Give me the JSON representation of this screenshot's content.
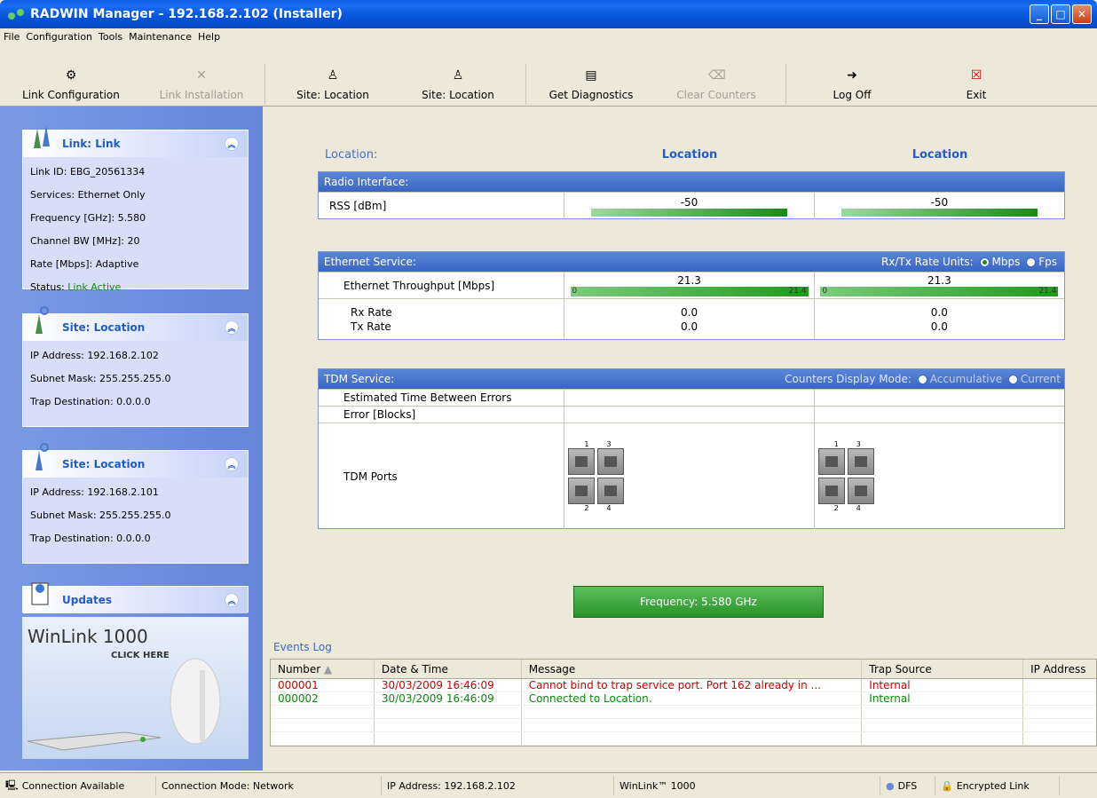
{
  "window": {
    "title": "RADWIN Manager - 192.168.2.102 (Installer)"
  },
  "menu": [
    "File",
    "Configuration",
    "Tools",
    "Maintenance",
    "Help"
  ],
  "toolbar": {
    "link_configuration": "Link Configuration",
    "link_installation": "Link Installation",
    "site_location_1": "Site: Location",
    "site_location_2": "Site: Location",
    "get_diagnostics": "Get Diagnostics",
    "clear_counters": "Clear Counters",
    "log_off": "Log Off",
    "exit": "Exit"
  },
  "link_panel": {
    "title": "Link: Link",
    "link_id": "Link ID:  EBG_20561334",
    "services": "Services:  Ethernet Only",
    "frequency": "Frequency [GHz]:  5.580",
    "channel_bw": "Channel BW [MHz]:  20",
    "rate": "Rate [Mbps]:  Adaptive",
    "status_label": "Status:",
    "status_value": "Link Active"
  },
  "site1_panel": {
    "title": "Site: Location",
    "ip": "IP Address:  192.168.2.102",
    "mask": "Subnet Mask:  255.255.255.0",
    "trap": "Trap Destination:  0.0.0.0"
  },
  "site2_panel": {
    "title": "Site: Location",
    "ip": "IP Address:  192.168.2.101",
    "mask": "Subnet Mask:  255.255.255.0",
    "trap": "Trap Destination:  0.0.0.0"
  },
  "updates_panel": {
    "title": "Updates",
    "ad_title": "WinLink 1000",
    "ad_sub": "CLICK HERE"
  },
  "main": {
    "location_label": "Location:",
    "site_a": "Location",
    "site_b": "Location",
    "radio": {
      "header": "Radio Interface:",
      "rss_label": "RSS [dBm]",
      "rss_a": "-50",
      "rss_b": "-50",
      "rss_a_level": 0.85,
      "rss_b_level": 0.85
    },
    "ethernet": {
      "header": "Ethernet Service:",
      "units_label": "Rx/Tx Rate Units:",
      "mbps": "Mbps",
      "fps": "Fps",
      "throughput_label": "Ethernet Throughput [Mbps]",
      "tp_a": "21.3",
      "tp_b": "21.3",
      "scale_min": "0",
      "scale_max": "21.4",
      "rx_label": "Rx Rate",
      "tx_label": "Tx Rate",
      "rx_a": "0.0",
      "rx_b": "0.0",
      "tx_a": "0.0",
      "tx_b": "0.0"
    },
    "tdm": {
      "header": "TDM Service:",
      "mode_label": "Counters Display Mode:",
      "accumulative": "Accumulative",
      "current": "Current",
      "etbe_label": "Estimated Time Between Errors",
      "error_label": "Error [Blocks]",
      "ports_label": "TDM Ports",
      "port_nums": {
        "p1": "1",
        "p2": "2",
        "p3": "3",
        "p4": "4"
      }
    },
    "frequency_button": "Frequency: 5.580 GHz"
  },
  "events": {
    "title": "Events Log",
    "columns": [
      "Number",
      "Date & Time",
      "Message",
      "Trap Source",
      "IP Address"
    ],
    "rows": [
      {
        "number": "000001",
        "datetime": "30/03/2009 16:46:09",
        "message": "Cannot bind to trap service port. Port 162 already in ...",
        "source": "Internal"
      },
      {
        "number": "000002",
        "datetime": "30/03/2009 16:46:09",
        "message": "Connected to Location.",
        "source": "Internal"
      }
    ]
  },
  "status": {
    "connection": "Connection Available",
    "mode": "Connection Mode: Network",
    "ip": "IP Address: 192.168.2.102",
    "product": "WinLink™ 1000",
    "dfs": "DFS",
    "encrypted": "Encrypted Link"
  }
}
